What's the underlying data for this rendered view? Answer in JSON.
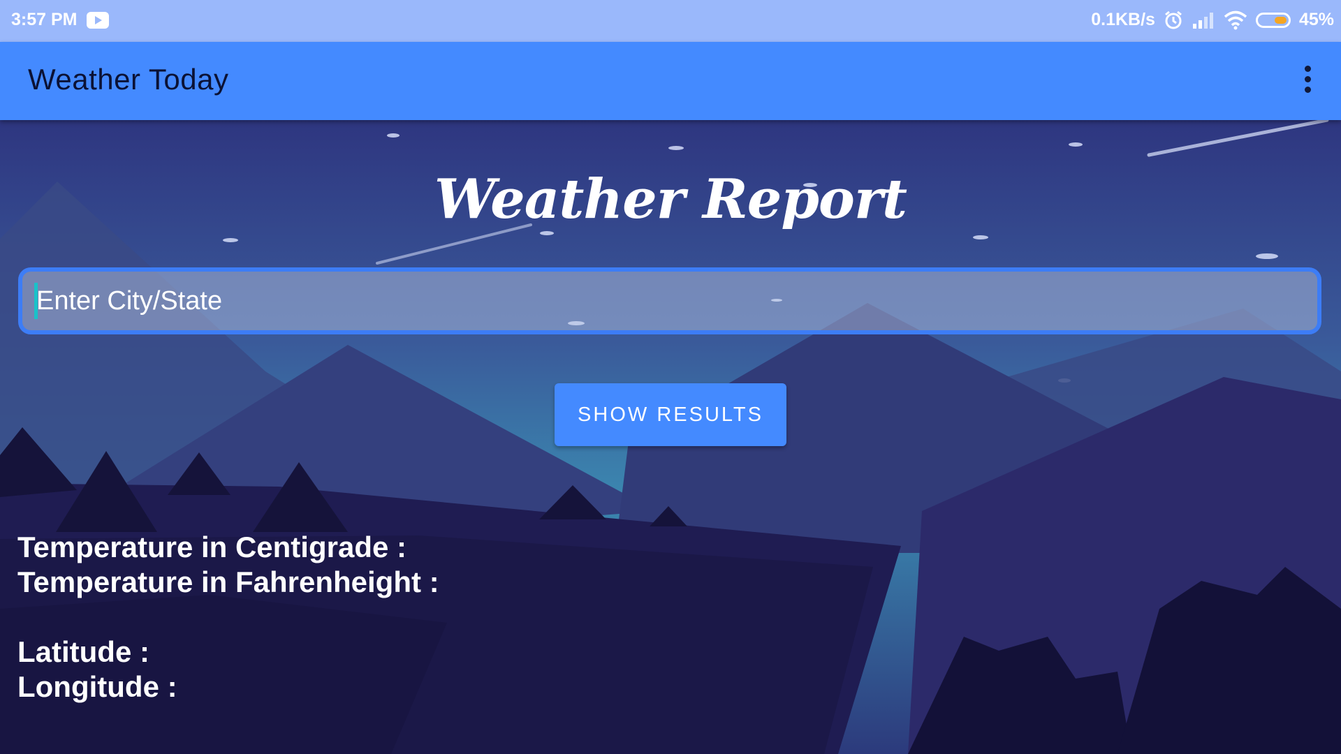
{
  "status_bar": {
    "time": "3:57 PM",
    "network_speed": "0.1KB/s",
    "battery_percent": "45%",
    "battery_level": 0.45,
    "icons": [
      "youtube-icon",
      "alarm-icon",
      "signal-icon",
      "wifi-icon",
      "battery-icon"
    ]
  },
  "app_bar": {
    "title": "Weather Today",
    "menu_icon": "more-vert-icon"
  },
  "main": {
    "heading": "Weather Report",
    "city_input": {
      "placeholder": "Enter City/State",
      "value": ""
    },
    "show_button_label": "SHOW RESULTS",
    "temp_c_label": "Temperature in Centigrade :",
    "temp_f_label": "Temperature in Fahrenheight :",
    "latitude_label": "Latitude :",
    "longitude_label": "Longitude :"
  },
  "colors": {
    "status_bar": "#9ab8fb",
    "app_bar": "#448aff",
    "button": "#448aff",
    "input_border": "#3d7df6",
    "caret": "#19c2c9"
  }
}
